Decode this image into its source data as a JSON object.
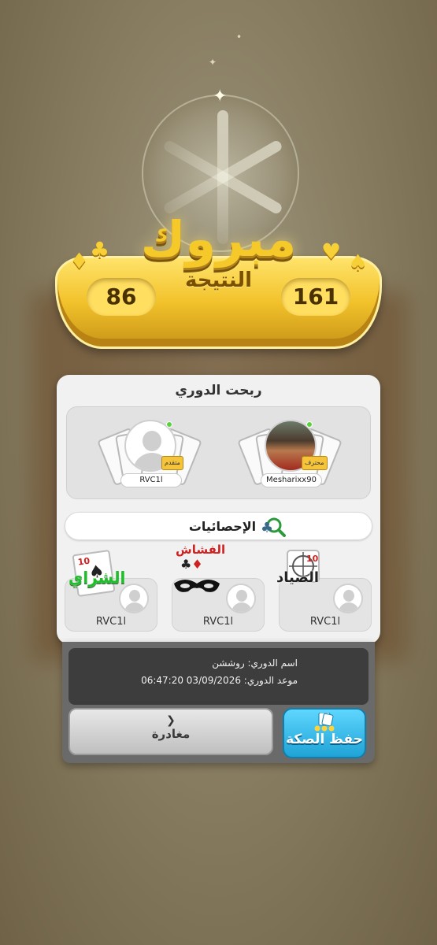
{
  "banner": {
    "title": "مبروك",
    "subtitle": "النتيجة",
    "score_left": "86",
    "score_right": "161"
  },
  "panel": {
    "title": "ربحت الدوري",
    "winners": [
      {
        "name": "RVC1l",
        "rank": "متقدم"
      },
      {
        "name": "Mesharixx90",
        "rank": "محترف"
      }
    ],
    "stats_label": "الإحصائيات",
    "awards": [
      {
        "title": "الشراي",
        "name": "RVC1l",
        "color": "#1fbf2a"
      },
      {
        "title": "الفشاش",
        "name": "RVC1l",
        "color": "#d12020"
      },
      {
        "title": "الصياد",
        "name": "RVC1l",
        "color": "#222222"
      }
    ]
  },
  "info": {
    "league_name": "اسم الدوري: روششن",
    "league_date": "موعد الدوري: 03/09/2026 06:47:20"
  },
  "buttons": {
    "exit_label": "مغادرة",
    "save_label": "حفظ الصكة"
  }
}
